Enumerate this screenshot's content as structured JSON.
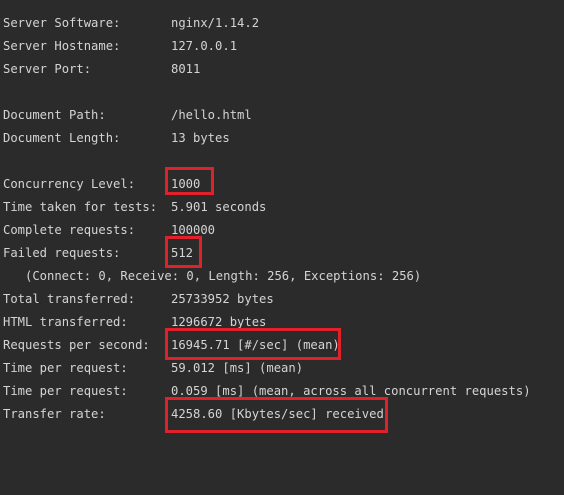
{
  "theme": {
    "background": "#2b2b2b",
    "text": "#d4d4d4",
    "highlight": "#e0202a"
  },
  "server": {
    "software_label": "Server Software:",
    "software_value": "nginx/1.14.2",
    "hostname_label": "Server Hostname:",
    "hostname_value": "127.0.0.1",
    "port_label": "Server Port:",
    "port_value": "8011"
  },
  "document": {
    "path_label": "Document Path:",
    "path_value": "/hello.html",
    "length_label": "Document Length:",
    "length_value": "13 bytes"
  },
  "results": {
    "concurrency_label": "Concurrency Level:",
    "concurrency_value": "1000",
    "time_taken_label": "Time taken for tests:",
    "time_taken_value": "5.901 seconds",
    "complete_label": "Complete requests:",
    "complete_value": "100000",
    "failed_label": "Failed requests:",
    "failed_value": "512",
    "failed_detail": "(Connect: 0, Receive: 0, Length: 256, Exceptions: 256)",
    "total_transferred_label": "Total transferred:",
    "total_transferred_value": "25733952 bytes",
    "html_transferred_label": "HTML transferred:",
    "html_transferred_value": "1296672 bytes",
    "rps_label": "Requests per second:",
    "rps_value": "16945.71 [#/sec] (mean)",
    "tpr_label": "Time per request:",
    "tpr_value": "59.012 [ms] (mean)",
    "tpr_all_label": "Time per request:",
    "tpr_all_value": "0.059 [ms] (mean, across all concurrent requests)",
    "transfer_rate_label": "Transfer rate:",
    "transfer_rate_value": "4258.60 [Kbytes/sec] received"
  }
}
